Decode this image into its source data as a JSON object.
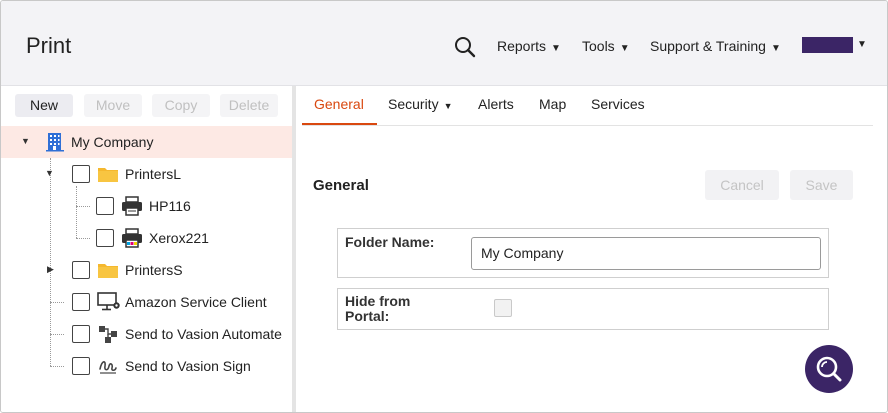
{
  "header": {
    "title": "Print",
    "menus": [
      {
        "label": "Reports"
      },
      {
        "label": "Tools"
      },
      {
        "label": "Support & Training"
      }
    ]
  },
  "toolbar": {
    "buttons": [
      {
        "label": "New",
        "enabled": true
      },
      {
        "label": "Move",
        "enabled": false
      },
      {
        "label": "Copy",
        "enabled": false
      },
      {
        "label": "Delete",
        "enabled": false
      }
    ]
  },
  "tree": {
    "root": {
      "label": "My Company",
      "icon": "building-icon",
      "selected": true,
      "expanded": true
    },
    "nodes": [
      {
        "label": "PrintersL",
        "icon": "folder-icon",
        "expanded": true
      },
      {
        "label": "HP116",
        "icon": "printer-icon"
      },
      {
        "label": "Xerox221",
        "icon": "color-printer-icon"
      },
      {
        "label": "PrintersS",
        "icon": "folder-icon",
        "expanded": false
      },
      {
        "label": "Amazon Service Client",
        "icon": "monitor-gear-icon"
      },
      {
        "label": "Send to Vasion Automate",
        "icon": "workflow-icon"
      },
      {
        "label": "Send to Vasion Sign",
        "icon": "signature-icon"
      }
    ]
  },
  "tabs": [
    {
      "label": "General",
      "active": true
    },
    {
      "label": "Security",
      "dropdown": true
    },
    {
      "label": "Alerts"
    },
    {
      "label": "Map"
    },
    {
      "label": "Services"
    }
  ],
  "panel": {
    "title": "General",
    "cancel_label": "Cancel",
    "save_label": "Save",
    "folder_name_label": "Folder Name:",
    "folder_name_value": "My Company",
    "hide_label_line1": "Hide from",
    "hide_label_line2": "Portal:",
    "hide_checked": false
  },
  "colors": {
    "accent": "#d9480f",
    "brand": "#3b2566",
    "folder": "#f5b82e",
    "building": "#2f6fd6",
    "selection": "#fde9e4"
  }
}
